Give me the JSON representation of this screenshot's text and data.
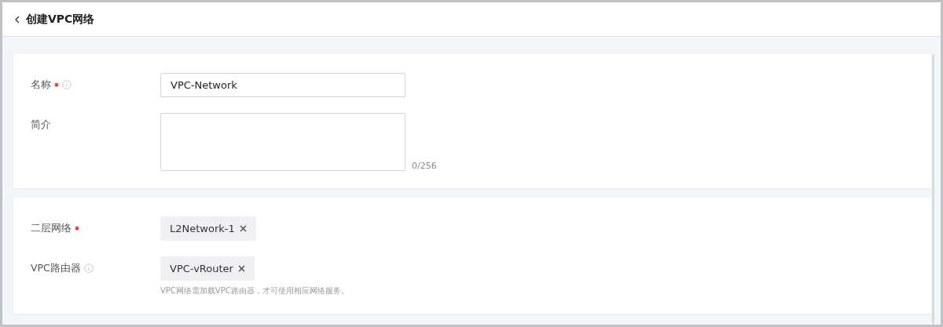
{
  "header": {
    "title": "创建VPC网络"
  },
  "sections": [
    {
      "fields": [
        {
          "kind": "input",
          "label": "名称",
          "required": true,
          "info": true,
          "value": "VPC-Network"
        },
        {
          "kind": "textarea",
          "label": "简介",
          "required": false,
          "info": false,
          "counter": "0/256"
        }
      ]
    },
    {
      "fields": [
        {
          "kind": "tags",
          "label": "二层网络",
          "required": true,
          "info": false,
          "tags": [
            "L2Network-1"
          ]
        },
        {
          "kind": "tags",
          "label": "VPC路由器",
          "required": false,
          "info": true,
          "tags": [
            "VPC-vRouter"
          ],
          "hint": "VPC网络需加载VPC路由器，才可使用相应网络服务。"
        }
      ]
    }
  ]
}
